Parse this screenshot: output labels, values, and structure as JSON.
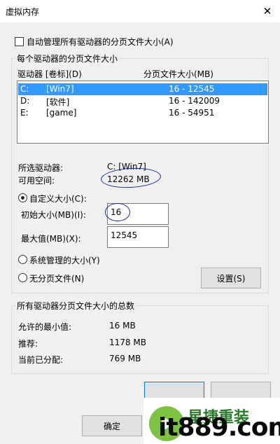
{
  "window": {
    "title": "虚拟内存",
    "close_label": "✕"
  },
  "auto_manage": {
    "label": "自动管理所有驱动器的分页文件大小(A)",
    "checked": false
  },
  "drives_group": {
    "title": "每个驱动器的分页文件大小",
    "col_drive": "驱动器 [卷标](D)",
    "col_size": "分页文件大小(MB)",
    "rows": [
      {
        "letter": "C:",
        "label": "[Win7]",
        "size": "16 - 12545",
        "selected": true
      },
      {
        "letter": "D:",
        "label": "[软件]",
        "size": "16 - 142009",
        "selected": false
      },
      {
        "letter": "E:",
        "label": "[game]",
        "size": "16 - 54951",
        "selected": false
      }
    ],
    "selected_drive_label": "所选驱动器:",
    "selected_drive_value": "C:  [Win7]",
    "free_space_label": "可用空间:",
    "free_space_value": "12262 MB",
    "custom_size_label": "自定义大小(C):",
    "initial_size_label": "初始大小(MB)(I):",
    "initial_size_value": "16",
    "max_size_label": "最大值(MB)(X):",
    "max_size_value": "12545",
    "system_managed_label": "系统管理的大小(Y)",
    "no_paging_label": "无分页文件(N)",
    "set_button": "设置(S)"
  },
  "totals_group": {
    "title": "所有驱动器分页文件大小的总数",
    "min_label": "允许的最小值:",
    "min_value": "16 MB",
    "recommended_label": "推荐:",
    "recommended_value": "1178 MB",
    "allocated_label": "当前已分配:",
    "allocated_value": "769 MB"
  },
  "footer": {
    "ok_button": "确定"
  },
  "watermark": {
    "cn_text": "星捷重装",
    "domain_text": "it889.com"
  },
  "colors": {
    "selection": "#3399ff",
    "annotation": "#1a2a8f",
    "watermark_logo": "#7dc242"
  }
}
